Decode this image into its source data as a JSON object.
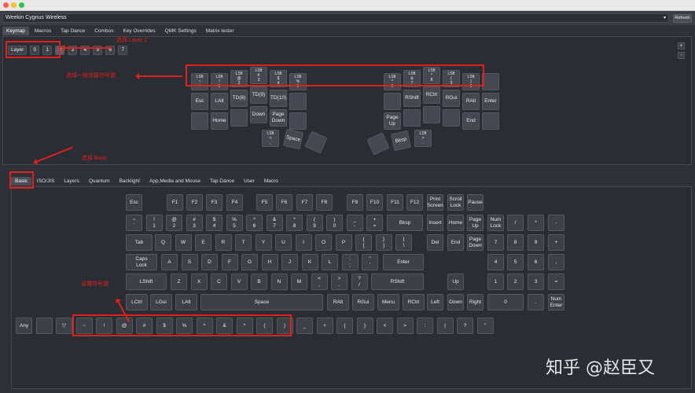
{
  "window": {
    "device": "Weekin Cygnus Wireless",
    "refresh_label": "Refresh"
  },
  "main_tabs": [
    "Keymap",
    "Macros",
    "Tap Dance",
    "Combos",
    "Key Overrides",
    "QMK Settings",
    "Matrix tester"
  ],
  "layers": {
    "label": "Layer",
    "items": [
      "0",
      "1",
      "2",
      "3",
      "4",
      "5",
      "6",
      "7"
    ],
    "selected": "2"
  },
  "annotations": {
    "layer": "选择 Layer 2",
    "keys": "选择一级设置符号键",
    "basic": "选择 Basic",
    "symbols": "设置符号键"
  },
  "keyboard": {
    "left": [
      [
        "LSft\n~\n`",
        "LSft\n!\n1",
        "LSft\n@\n2",
        "LSft\n#\n3",
        "LSft\n$\n4",
        "LSft\n%\n5"
      ],
      [
        "Esc",
        "LAlt",
        "TD(8)",
        "TD(9)",
        "TD(10)",
        ""
      ],
      [
        "",
        "Home",
        "",
        "Down",
        "Page\nDown",
        ""
      ],
      [
        "LSft\n<\n,",
        "Space",
        ""
      ]
    ],
    "right": [
      [
        "LSft\n^\n6",
        "LSft\n&\n7",
        "LSft\n*\n8",
        "LSft\n(\n9",
        "LSft\n)\n0",
        ""
      ],
      [
        "",
        "RShift",
        "RCtrl",
        "RGui",
        "RAlt",
        "Enter"
      ],
      [
        "Page\nUp",
        "",
        "",
        "",
        "End",
        ""
      ],
      [
        "",
        "Bksp",
        "LSft\n>\n."
      ]
    ]
  },
  "picker_tabs": [
    "Basic",
    "ISO/JIS",
    "Layers",
    "Quantum",
    "Backlight",
    "App,Media and Mouse",
    "Tap Dance",
    "User",
    "Macro"
  ],
  "picker_active": "Basic",
  "picker_keys": {
    "r1": [
      "Esc",
      "F1",
      "F2",
      "F3",
      "F4",
      "F5",
      "F6",
      "F7",
      "F8",
      "F9",
      "F10",
      "F11",
      "F12",
      "Print\nScreen",
      "Scroll\nLock",
      "Pause"
    ],
    "r2": [
      "~\n`",
      "!\n1",
      "@\n2",
      "#\n3",
      "$\n4",
      "%\n5",
      "^\n6",
      "&\n7",
      "*\n8",
      "(\n9",
      ")\n0",
      "_\n-",
      "+\n=",
      "Bksp",
      "Insert",
      "Home",
      "Page\nUp",
      "Num\nLock",
      "/",
      "*",
      "-"
    ],
    "r3": [
      "Tab",
      "Q",
      "W",
      "E",
      "R",
      "T",
      "Y",
      "U",
      "I",
      "O",
      "P",
      "{\n[",
      "}\n]",
      "|\n\\",
      "Del",
      "End",
      "Page\nDown",
      "7",
      "8",
      "9",
      "+"
    ],
    "r4": [
      "Caps\nLock",
      "A",
      "S",
      "D",
      "F",
      "G",
      "H",
      "J",
      "K",
      "L",
      ":\n;",
      "\"\n'",
      "Enter",
      "4",
      "5",
      "6",
      ","
    ],
    "r5": [
      "LShift",
      "Z",
      "X",
      "C",
      "V",
      "B",
      "N",
      "M",
      "<\n,",
      ">\n.",
      "?\n/",
      "RShift",
      "Up",
      "1",
      "2",
      "3",
      "="
    ],
    "r6": [
      "LCtrl",
      "LGui",
      "LAlt",
      "Space",
      "RAlt",
      "RGui",
      "Menu",
      "RCtrl",
      "Left",
      "Down",
      "Right",
      "0",
      ".",
      "Num\nEnter"
    ],
    "r7": [
      "Any",
      "",
      "▽",
      "~",
      "!",
      "@",
      "#",
      "$",
      "%",
      "^",
      "&",
      "*",
      "(",
      ")",
      "_",
      "+",
      "{",
      "}",
      "<",
      ">",
      ":",
      "|",
      "?",
      "\""
    ]
  },
  "watermark": "知乎 @赵臣又"
}
